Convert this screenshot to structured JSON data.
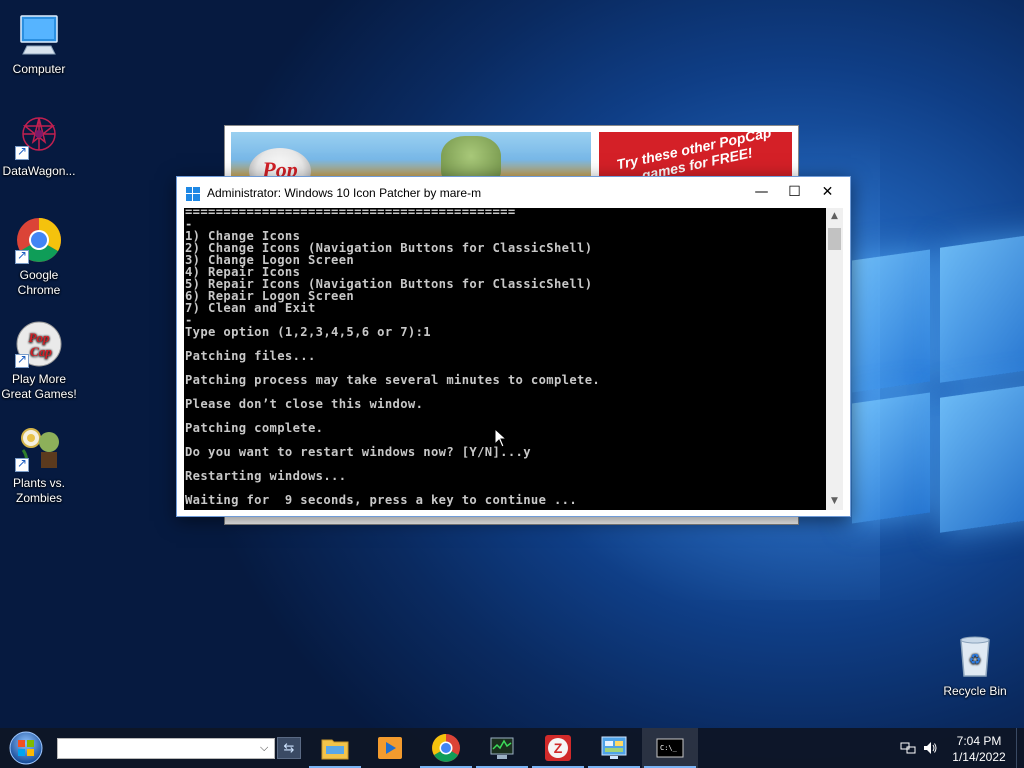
{
  "desktop": {
    "icons": [
      {
        "id": "computer",
        "label": "Computer"
      },
      {
        "id": "datawagon",
        "label": "DataWagon..."
      },
      {
        "id": "chrome",
        "label": "Google Chrome"
      },
      {
        "id": "popcap",
        "label": "Play More Great Games!"
      },
      {
        "id": "pvz",
        "label": "Plants vs. Zombies"
      },
      {
        "id": "recycle",
        "label": "Recycle Bin"
      }
    ]
  },
  "background_window": {
    "logo_text": "Pop",
    "promo_text": "Try these other PopCap games for FREE!"
  },
  "console": {
    "title": "Administrator:  Windows 10 Icon Patcher by mare-m",
    "minimize": "—",
    "maximize": "☐",
    "close": "✕",
    "lines": [
      "===========================================",
      "-",
      "1) Change Icons",
      "2) Change Icons (Navigation Buttons for ClassicShell)",
      "3) Change Logon Screen",
      "4) Repair Icons",
      "5) Repair Icons (Navigation Buttons for ClassicShell)",
      "6) Repair Logon Screen",
      "7) Clean and Exit",
      "-",
      "Type option (1,2,3,4,5,6 or 7):1",
      "",
      "Patching files...",
      "",
      "Patching process may take several minutes to complete.",
      "",
      "Please don’t close this window.",
      "",
      "Patching complete.",
      "",
      "Do you want to restart windows now? [Y/N]...y",
      "",
      "Restarting windows...",
      "",
      "Waiting for  9 seconds, press a key to continue ..."
    ]
  },
  "taskbar": {
    "search_placeholder": "",
    "apps": [
      {
        "id": "explorer",
        "name": "File Explorer"
      },
      {
        "id": "media",
        "name": "Media Player"
      },
      {
        "id": "chrome",
        "name": "Google Chrome"
      },
      {
        "id": "taskmgr",
        "name": "Task Manager"
      },
      {
        "id": "zapp",
        "name": "App"
      },
      {
        "id": "control",
        "name": "Control Panel"
      },
      {
        "id": "cmd",
        "name": "Command Prompt"
      }
    ],
    "clock": {
      "time": "7:04 PM",
      "date": "1/14/2022"
    }
  },
  "colors": {
    "accent": "#7ab4f5",
    "console_bg": "#000000",
    "console_fg": "#c8c8c8"
  }
}
